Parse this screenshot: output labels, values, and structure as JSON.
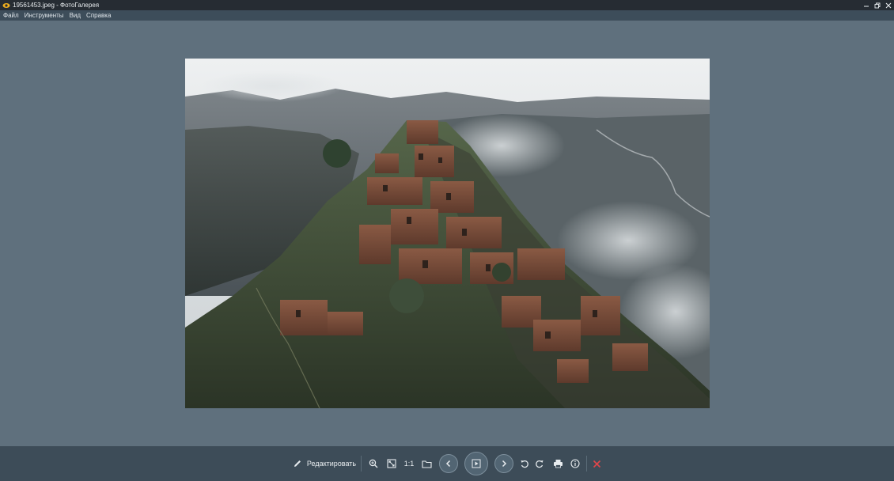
{
  "window": {
    "title": "19561453.jpeg - ФотоГалерея"
  },
  "menu": {
    "items": [
      "Файл",
      "Инструменты",
      "Вид",
      "Справка"
    ]
  },
  "toolbar": {
    "edit_label": "Редактировать",
    "actual_size_label": "1:1"
  },
  "colors": {
    "background": "#5f707d",
    "titlebar": "#262c33",
    "menubar": "#3d4d5a",
    "toolbar": "#3d4c58",
    "close_accent": "#e0464a"
  },
  "icons": [
    "eye-icon",
    "minimize-icon",
    "maximize-icon",
    "close-icon",
    "pencil-icon",
    "zoom-in-icon",
    "fit-screen-icon",
    "folder-icon",
    "chevron-left-icon",
    "play-icon",
    "chevron-right-icon",
    "rotate-left-icon",
    "rotate-right-icon",
    "printer-icon",
    "info-icon",
    "delete-icon"
  ]
}
